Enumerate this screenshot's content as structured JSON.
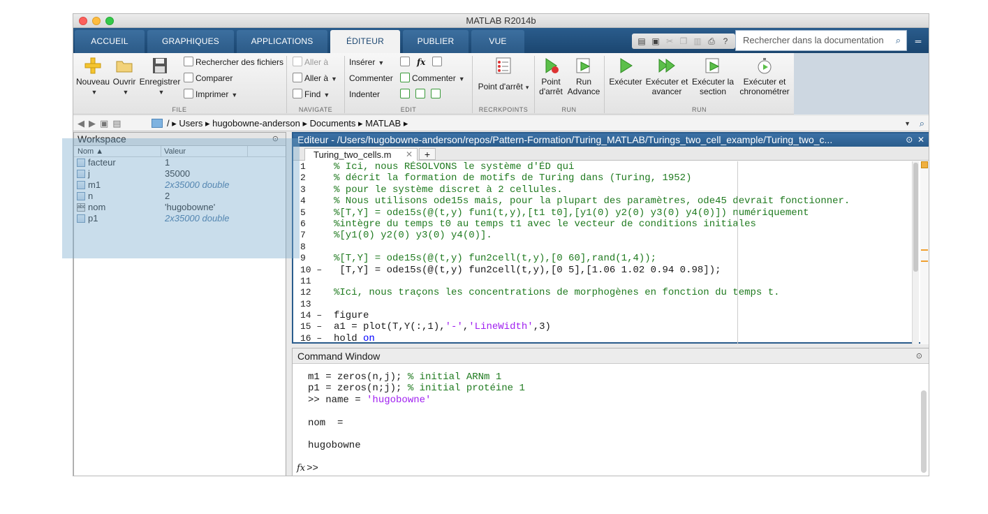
{
  "window": {
    "title": "MATLAB R2014b"
  },
  "tabs": [
    "ACCUEIL",
    "GRAPHIQUES",
    "APPLICATIONS",
    "ÉDITEUR",
    "PUBLIER",
    "VUE"
  ],
  "search": {
    "placeholder": "Rechercher dans la documentation"
  },
  "ribbon": {
    "file": {
      "label": "FILE",
      "nouveau": "Nouveau",
      "ouvrir": "Ouvrir",
      "enregistrer": "Enregistrer",
      "rechercher": "Rechercher des fichiers",
      "comparer": "Comparer",
      "imprimer": "Imprimer"
    },
    "navigate": {
      "label": "NAVIGATE",
      "aller_a_1": "Aller à",
      "aller_a_2": "Aller à",
      "find": "Find"
    },
    "edit": {
      "label": "EDIT",
      "inserer": "Insérer",
      "commenter": "Commenter",
      "indenter": "Indenter",
      "commenter2": "Commenter",
      "fx": "fx"
    },
    "breakpoints": {
      "label": "RECRKPOINTS",
      "point_arret": "Point d'arrêt"
    },
    "run1": {
      "label": "RUN",
      "point_arret_1": "Point",
      "point_arret_2": "d'arrêt",
      "run_advance_1": "Run",
      "run_advance_2": "Advance"
    },
    "run2": {
      "label": "RUN",
      "executer": "Exécuter",
      "exec_avancer_1": "Exécuter et",
      "exec_avancer_2": "avancer",
      "exec_section_1": "Exécuter la",
      "exec_section_2": "section",
      "exec_chrono_1": "Exécuter et",
      "exec_chrono_2": "chronométrer"
    }
  },
  "address": {
    "root": "/",
    "parts": [
      "Users",
      "hugobowne-anderson",
      "Documents",
      "MATLAB"
    ]
  },
  "workspace": {
    "title": "Workspace",
    "col_name": "Nom ▲",
    "col_value": "Valeur",
    "vars": [
      {
        "name": "facteur",
        "value": "1",
        "italic": false,
        "type": "mat"
      },
      {
        "name": "j",
        "value": "35000",
        "italic": false,
        "type": "mat"
      },
      {
        "name": "m1",
        "value": "2x35000 double",
        "italic": true,
        "type": "mat"
      },
      {
        "name": "n",
        "value": "2",
        "italic": false,
        "type": "mat"
      },
      {
        "name": "nom",
        "value": "'hugobowne'",
        "italic": false,
        "type": "char"
      },
      {
        "name": "p1",
        "value": "2x35000 double",
        "italic": true,
        "type": "mat"
      }
    ]
  },
  "editor": {
    "title": "Editeur - /Users/hugobowne-anderson/repos/Pattern-Formation/Turing_MATLAB/Turings_two_cell_example/Turing_two_c...",
    "tab": "Turing_two_cells.m",
    "lines": [
      {
        "n": "1",
        "segs": [
          [
            "cm",
            "% Ici, nous RÉSOLVONS le système d'ÉD qui"
          ]
        ]
      },
      {
        "n": "2",
        "segs": [
          [
            "cm",
            "% décrit la formation de motifs de Turing dans (Turing, 1952)"
          ]
        ]
      },
      {
        "n": "3",
        "segs": [
          [
            "cm",
            "% pour le système discret à 2 cellules."
          ]
        ]
      },
      {
        "n": "4",
        "segs": [
          [
            "cm",
            "% Nous utilisons ode15s mais, pour la plupart des paramètres, ode45 devrait fonctionner."
          ]
        ]
      },
      {
        "n": "5",
        "segs": [
          [
            "cm",
            "%[T,Y] = ode15s(@(t,y) fun1(t,y),[t1 t0],[y1(0) y2(0) y3(0) y4(0)]) numériquement"
          ]
        ]
      },
      {
        "n": "6",
        "segs": [
          [
            "cm",
            "%intègre du temps t0 au temps t1 avec le vecteur de conditions initiales"
          ]
        ]
      },
      {
        "n": "7",
        "segs": [
          [
            "cm",
            "%[y1(0) y2(0) y3(0) y4(0)]."
          ]
        ]
      },
      {
        "n": "8",
        "segs": []
      },
      {
        "n": "9",
        "segs": [
          [
            "cm",
            "%[T,Y] = ode15s(@(t,y) fun2cell(t,y),[0 60],rand(1,4));"
          ]
        ]
      },
      {
        "n": "10 –",
        "segs": [
          [
            "",
            " [T,Y] = ode15s(@(t,y) fun2cell(t,y),[0 5],[1.06 1.02 0.94 0.98]);"
          ]
        ]
      },
      {
        "n": "11",
        "segs": []
      },
      {
        "n": "12",
        "segs": [
          [
            "cm",
            "%Ici, nous traçons les concentrations de morphogènes en fonction du temps t."
          ]
        ]
      },
      {
        "n": "13",
        "segs": []
      },
      {
        "n": "14 –",
        "segs": [
          [
            "",
            "figure"
          ]
        ]
      },
      {
        "n": "15 –",
        "segs": [
          [
            "",
            "a1 = plot(T,Y(:,1),"
          ],
          [
            "st",
            "'-'"
          ],
          [
            "",
            ","
          ],
          [
            "st",
            "'LineWidth'"
          ],
          [
            "",
            ",3)"
          ]
        ]
      },
      {
        "n": "16 –",
        "segs": [
          [
            "",
            "hold "
          ],
          [
            "kw",
            "on"
          ]
        ]
      }
    ]
  },
  "command": {
    "title": "Command Window",
    "lines": [
      {
        "segs": [
          [
            "",
            "m1 = zeros(n,j); "
          ],
          [
            "cm",
            "% initial ARNm 1"
          ]
        ]
      },
      {
        "segs": [
          [
            "",
            "p1 = zeros(n;j); "
          ],
          [
            "cm",
            "% initial protéine 1"
          ]
        ]
      },
      {
        "segs": [
          [
            "",
            ">> name = "
          ],
          [
            "st",
            "'hugobowne'"
          ]
        ]
      },
      {
        "segs": []
      },
      {
        "segs": [
          [
            "",
            "nom  ="
          ]
        ]
      },
      {
        "segs": []
      },
      {
        "segs": [
          [
            "",
            "hugobowne"
          ]
        ]
      }
    ],
    "prompt": ">>",
    "fx": "fx"
  },
  "colors": {
    "ribbon_blue": "#1f4e79",
    "comment": "#1f7a1f",
    "string": "#a020f0",
    "keyword": "#0000ff"
  }
}
